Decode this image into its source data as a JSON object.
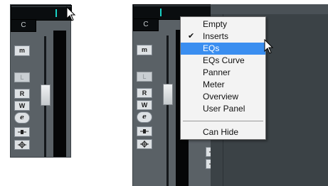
{
  "left_strip": {
    "channel_label": "C",
    "buttons": {
      "monitor": "m",
      "listen": "L",
      "read": "R",
      "write": "W",
      "edit": "e"
    }
  },
  "right_strip": {
    "channel_label": "C",
    "buttons": {
      "monitor": "m",
      "listen": "L",
      "read": "R",
      "write": "W",
      "edit": "e"
    }
  },
  "context_menu": {
    "items": [
      {
        "label": "Empty",
        "checked": false,
        "highlighted": false
      },
      {
        "label": "Inserts",
        "checked": true,
        "highlighted": false
      },
      {
        "label": "EQs",
        "checked": false,
        "highlighted": true
      },
      {
        "label": "EQs Curve",
        "checked": false,
        "highlighted": false
      },
      {
        "label": "Panner",
        "checked": false,
        "highlighted": false
      },
      {
        "label": "Meter",
        "checked": false,
        "highlighted": false
      },
      {
        "label": "Overview",
        "checked": false,
        "highlighted": false
      },
      {
        "label": "User Panel",
        "checked": false,
        "highlighted": false
      },
      {
        "label": "Can Hide",
        "checked": false,
        "highlighted": false
      }
    ],
    "check_glyph": "✔"
  },
  "colors": {
    "strip_bg": "#5a6166",
    "display_accent": "#19d1c4",
    "menu_highlight": "#3a8ef0"
  }
}
